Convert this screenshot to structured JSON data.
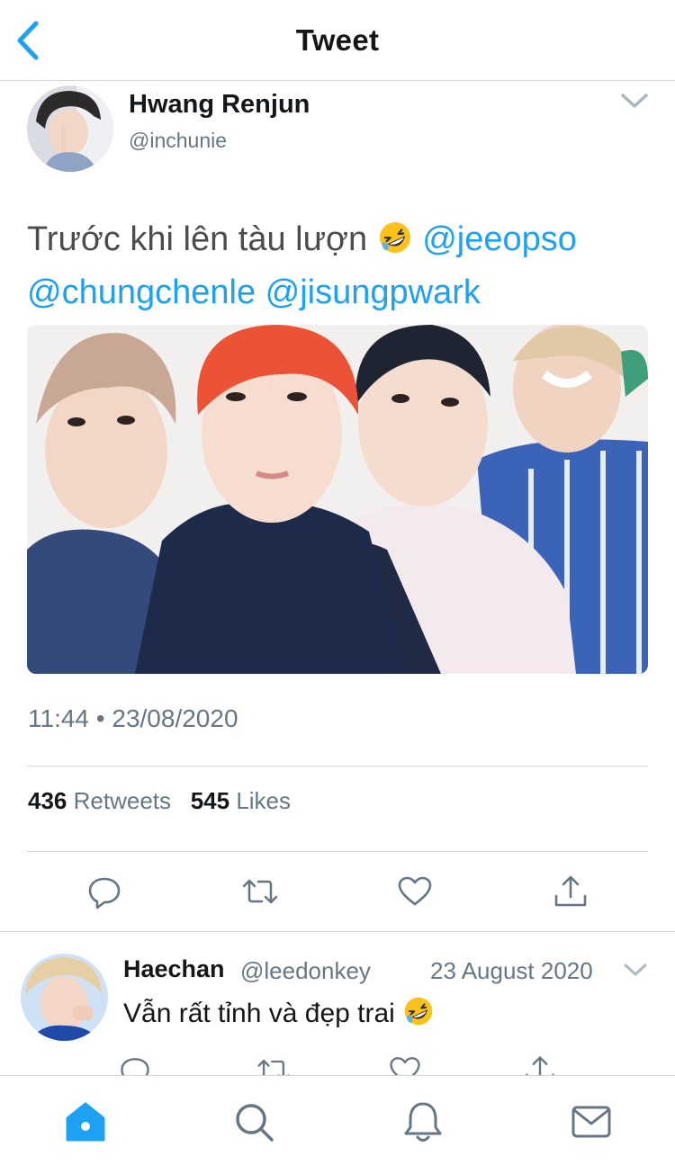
{
  "header": {
    "title": "Tweet",
    "back_icon": "chevron-left-icon"
  },
  "tweet": {
    "author": {
      "name": "Hwang Renjun",
      "handle": "@inchunie"
    },
    "text": "Trước khi lên tàu lượn",
    "emoji": "rolling-on-floor-laughing-emoji",
    "mentions": [
      "@jeeopso",
      "@chungchenle",
      "@jisungpwark"
    ],
    "time": "11:44",
    "separator": "•",
    "date": "23/08/2020",
    "stats": {
      "retweets": "436",
      "retweets_label": "Retweets",
      "likes": "545",
      "likes_label": "Likes"
    },
    "actions": [
      "reply-icon",
      "retweet-icon",
      "like-icon",
      "share-icon"
    ]
  },
  "reply": {
    "name": "Haechan",
    "handle": "@leedonkey",
    "date": "23 August 2020",
    "text": "Vẫn rất tỉnh và đẹp trai"
  },
  "tabbar": {
    "tabs": [
      "home-icon",
      "search-icon",
      "notifications-icon",
      "messages-icon"
    ],
    "active": "home-icon"
  },
  "colors": {
    "accent": "#1da1f2",
    "text": "#14171a",
    "secondary": "#657786",
    "divider": "#d3d8dc"
  }
}
